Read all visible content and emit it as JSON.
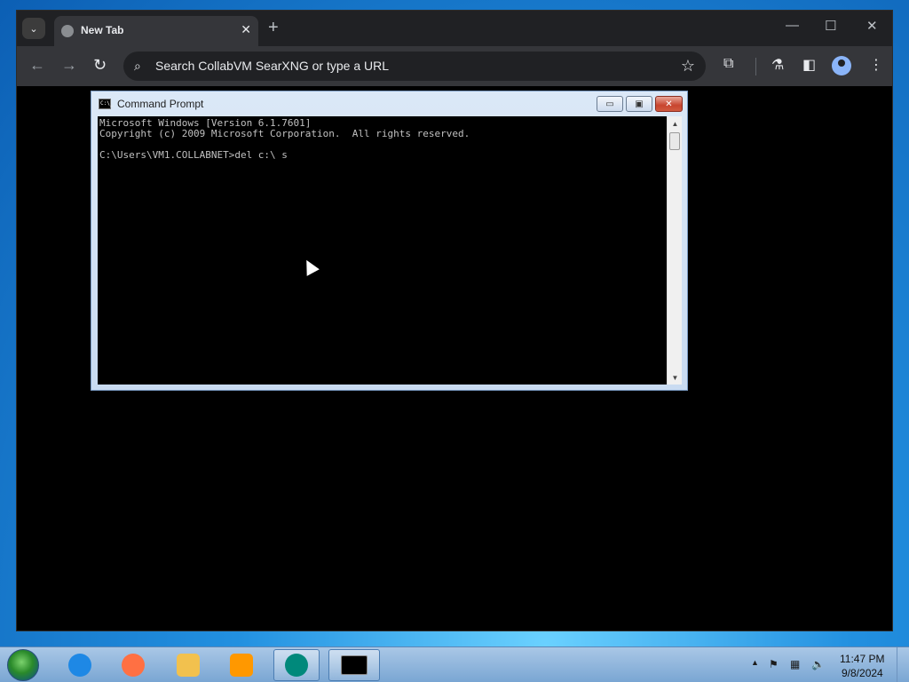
{
  "browser": {
    "tab_title": "New Tab",
    "tab_close": "✕",
    "new_tab": "+",
    "tab_search": "⌄",
    "omnibox_text": "Search CollabVM SearXNG or type a URL",
    "window_controls": {
      "minimize": "—",
      "maximize": "☐",
      "close": "✕"
    },
    "nav": {
      "back": "←",
      "forward": "→",
      "reload": "↻"
    }
  },
  "cmd": {
    "title": "Command Prompt",
    "icon_text": "C:\\_",
    "lines": [
      "Microsoft Windows [Version 6.1.7601]",
      "Copyright (c) 2009 Microsoft Corporation.  All rights reserved.",
      "",
      "C:\\Users\\VM1.COLLABNET>del c:\\ s"
    ],
    "buttons": {
      "minimize": "▭",
      "maximize": "▣",
      "close": "✕"
    }
  },
  "taskbar": {
    "apps": [
      {
        "name": "internet-explorer",
        "color": "#1e88e5"
      },
      {
        "name": "firefox",
        "color": "#ff7043"
      },
      {
        "name": "file-explorer",
        "color": "#f2c14e"
      },
      {
        "name": "media-player",
        "color": "#ff9800"
      },
      {
        "name": "browser-app",
        "color": "#00897b"
      },
      {
        "name": "command-prompt",
        "color": "#000000"
      }
    ],
    "tray_icons": [
      "show-hidden-icons",
      "action-center-flag",
      "network",
      "volume-muted"
    ],
    "clock": {
      "time": "11:47 PM",
      "date": "9/8/2024"
    }
  }
}
